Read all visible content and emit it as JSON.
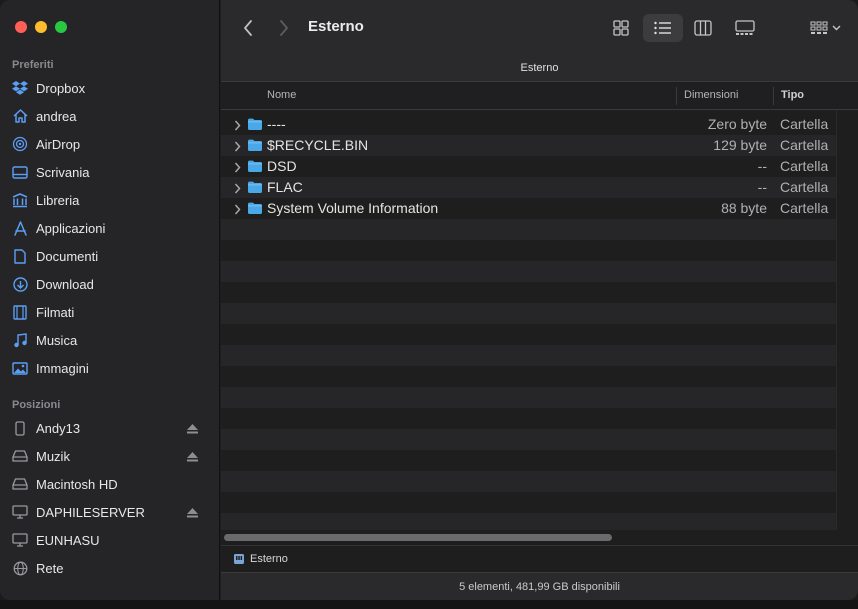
{
  "window": {
    "title": "Esterno"
  },
  "tab": {
    "label": "Esterno"
  },
  "sidebar": {
    "favorites_title": "Preferiti",
    "favorites": [
      {
        "label": "Dropbox",
        "icon": "dropbox-icon"
      },
      {
        "label": "andrea",
        "icon": "home-icon"
      },
      {
        "label": "AirDrop",
        "icon": "airdrop-icon"
      },
      {
        "label": "Scrivania",
        "icon": "desktop-icon"
      },
      {
        "label": "Libreria",
        "icon": "library-icon"
      },
      {
        "label": "Applicazioni",
        "icon": "applications-icon"
      },
      {
        "label": "Documenti",
        "icon": "document-icon"
      },
      {
        "label": "Download",
        "icon": "download-icon"
      },
      {
        "label": "Filmati",
        "icon": "movies-icon"
      },
      {
        "label": "Musica",
        "icon": "music-icon"
      },
      {
        "label": "Immagini",
        "icon": "pictures-icon"
      }
    ],
    "locations_title": "Posizioni",
    "locations": [
      {
        "label": "Andy13",
        "icon": "iphone-icon",
        "eject": true
      },
      {
        "label": "Muzik",
        "icon": "external-drive-icon",
        "eject": true
      },
      {
        "label": "Macintosh HD",
        "icon": "internal-drive-icon",
        "eject": false
      },
      {
        "label": "DAPHILESERVER",
        "icon": "server-icon",
        "eject": true
      },
      {
        "label": "EUNHASU",
        "icon": "server-icon",
        "eject": false
      },
      {
        "label": "Rete",
        "icon": "network-icon",
        "eject": false
      }
    ]
  },
  "columns": {
    "name": "Nome",
    "size": "Dimensioni",
    "kind": "Tipo"
  },
  "files": [
    {
      "name": "----",
      "size": "Zero byte",
      "kind": "Cartella"
    },
    {
      "name": "$RECYCLE.BIN",
      "size": "129 byte",
      "kind": "Cartella"
    },
    {
      "name": "DSD",
      "size": "--",
      "kind": "Cartella"
    },
    {
      "name": "FLAC",
      "size": "--",
      "kind": "Cartella"
    },
    {
      "name": "System Volume Information",
      "size": "88 byte",
      "kind": "Cartella"
    }
  ],
  "pathbar": {
    "label": "Esterno"
  },
  "status": {
    "text": "5 elementi, 481,99 GB disponibili"
  },
  "colors": {
    "accent_blue": "#3d8ef0",
    "folder_blue": "#4aa8e8"
  }
}
